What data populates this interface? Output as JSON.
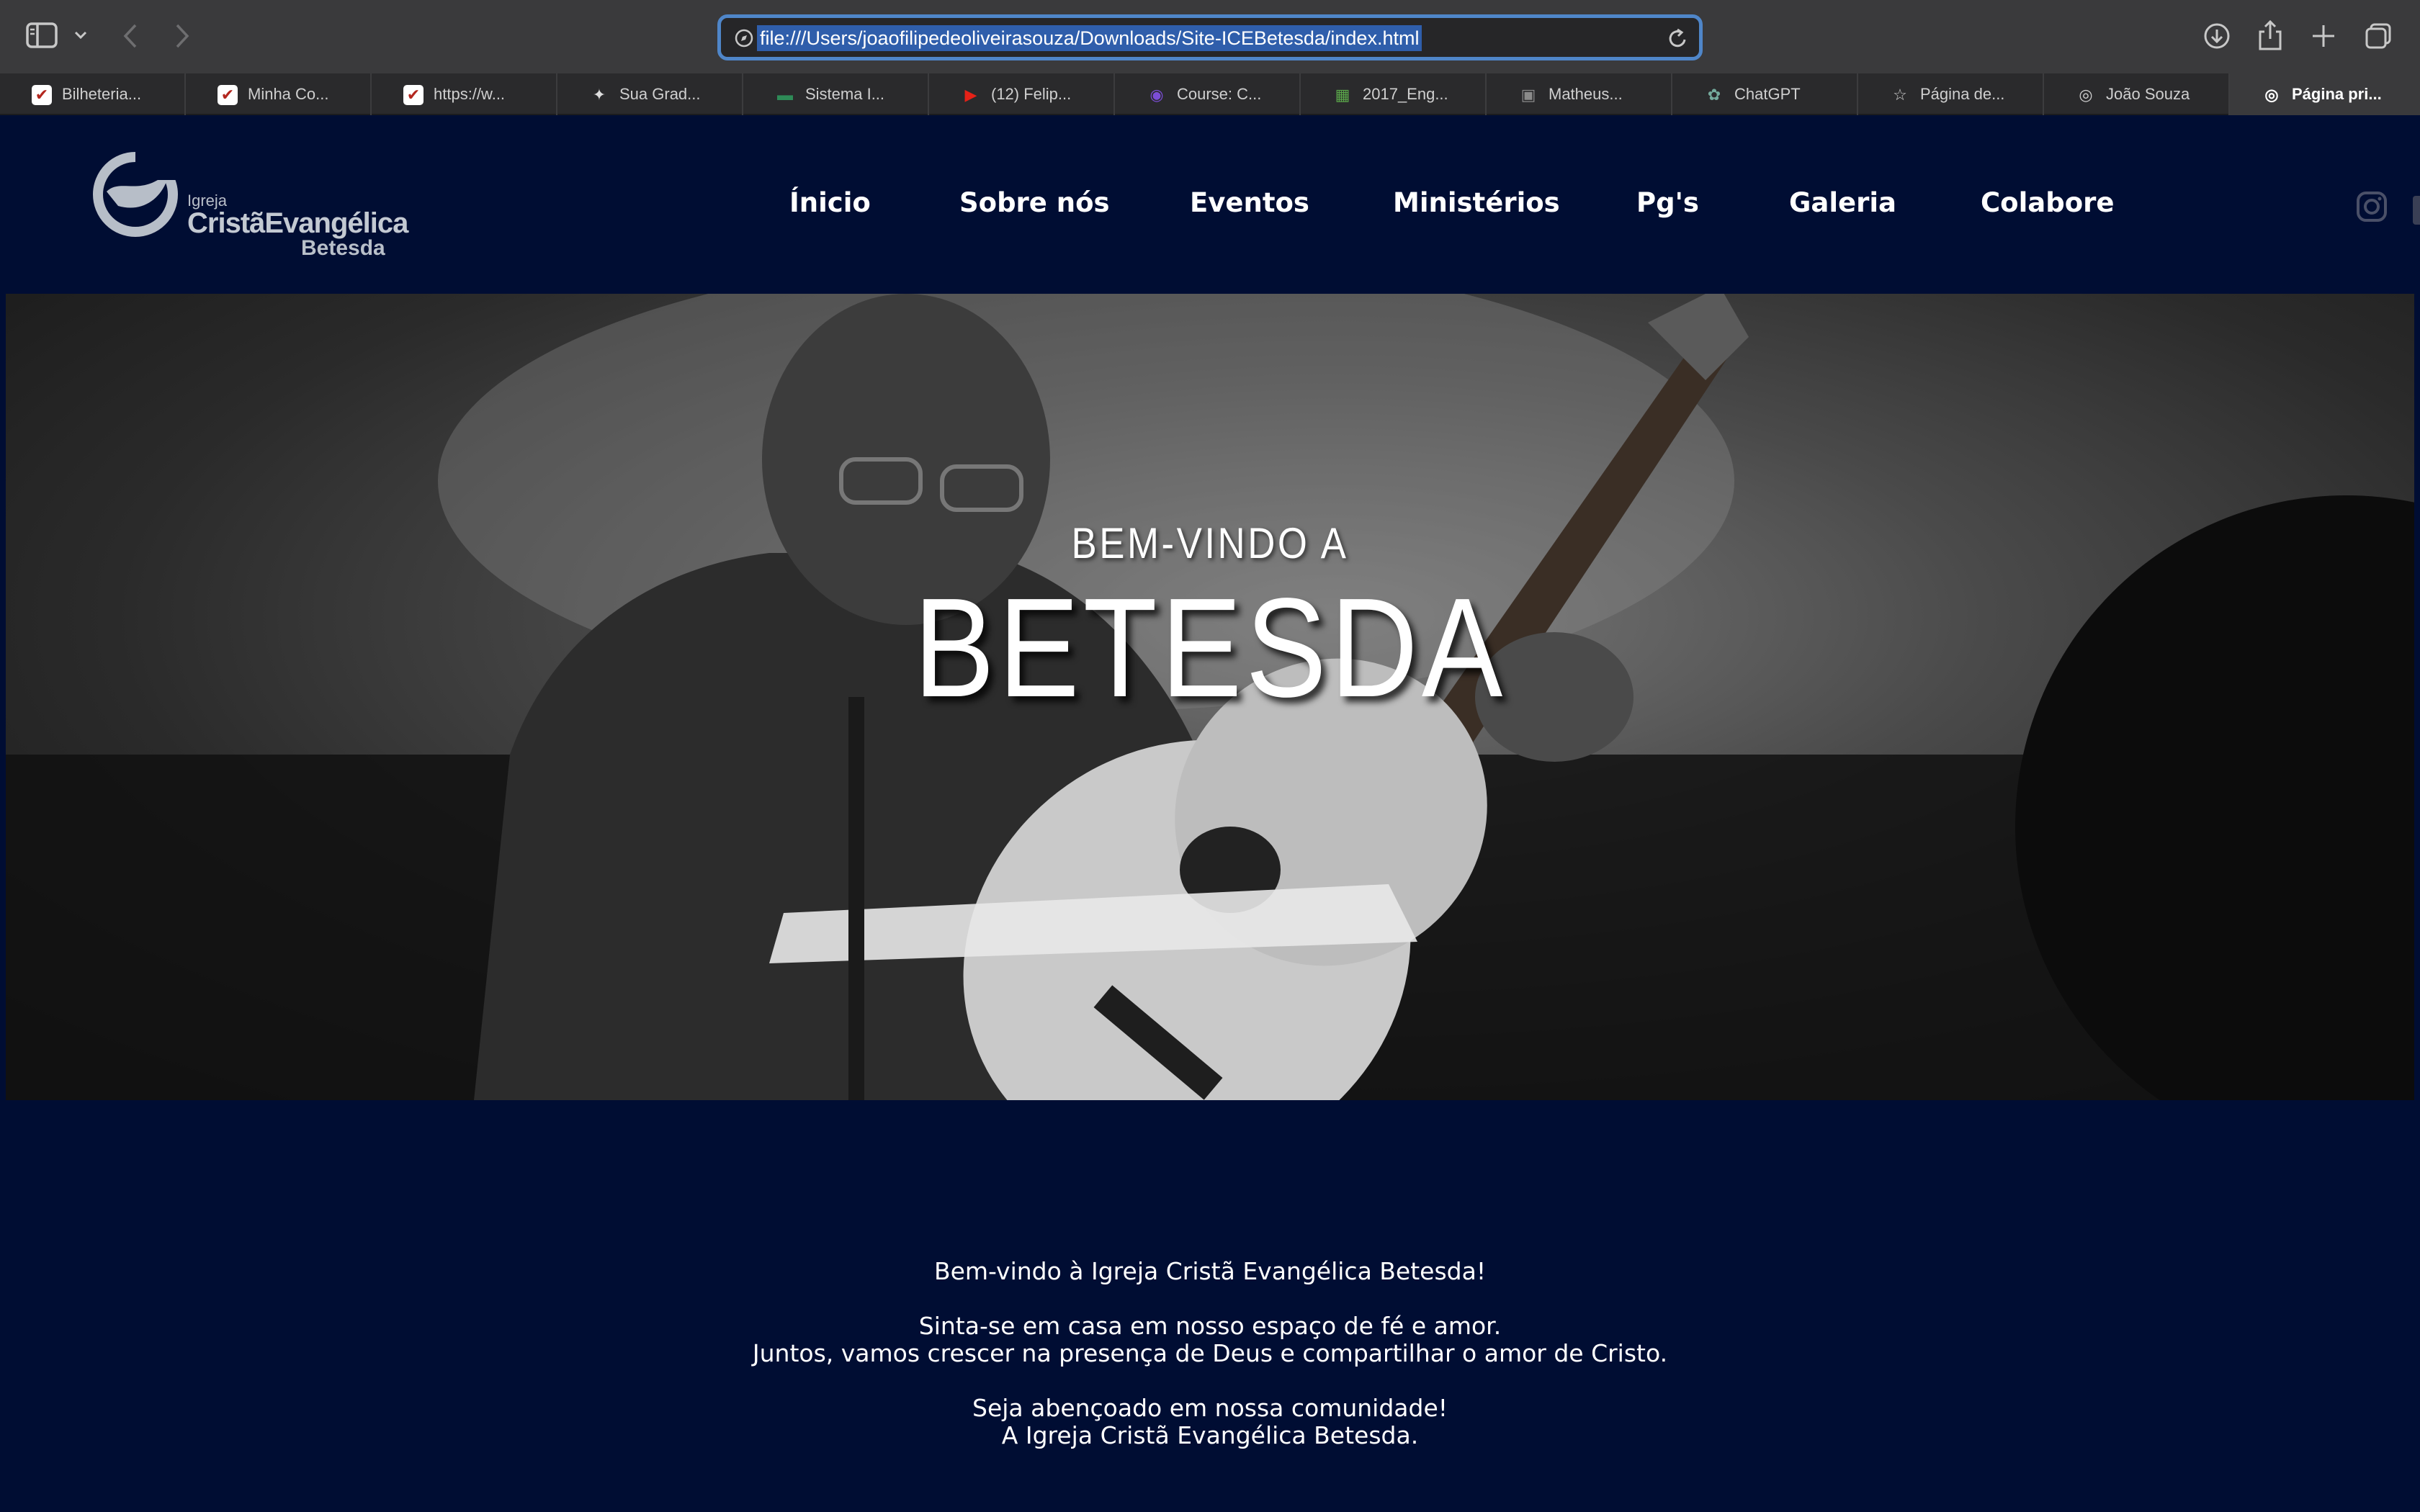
{
  "browser": {
    "url": "file:///Users/joaofilipedeoliveirasouza/Downloads/Site-ICEBetesda/index.html",
    "tabs": [
      {
        "label": "Bilheteria...",
        "icon": "ticket-icon",
        "color": "#ffffff"
      },
      {
        "label": "Minha Co...",
        "icon": "ticket-icon",
        "color": "#ffffff"
      },
      {
        "label": "https://w...",
        "icon": "ticket-icon",
        "color": "#ffffff"
      },
      {
        "label": "Sua Grad...",
        "icon": "cap-icon",
        "color": "#dddddd"
      },
      {
        "label": "Sistema I...",
        "icon": "flag-icon",
        "color": "#2e8b57"
      },
      {
        "label": "(12) Felip...",
        "icon": "youtube-icon",
        "color": "#e62117"
      },
      {
        "label": "Course: C...",
        "icon": "course-icon",
        "color": "#7b4dd6"
      },
      {
        "label": "2017_Eng...",
        "icon": "sheet-icon",
        "color": "#5aa64a"
      },
      {
        "label": "Matheus...",
        "icon": "photo-icon",
        "color": "#8a8a8a"
      },
      {
        "label": "ChatGPT",
        "icon": "chatgpt-icon",
        "color": "#74aa9c"
      },
      {
        "label": "Página de...",
        "icon": "star-icon",
        "color": "#cfcfcf"
      },
      {
        "label": "João Souza",
        "icon": "compass-icon",
        "color": "#cfcfcf"
      },
      {
        "label": "Página pri...",
        "icon": "compass-icon",
        "color": "#ffffff"
      }
    ]
  },
  "site": {
    "logo": {
      "line1": "Igreja",
      "line2": "CristãEvangélica",
      "line3": "Betesda"
    },
    "nav": [
      "Ínicio",
      "Sobre nós",
      "Eventos",
      "Ministérios",
      "Pg's",
      "Galeria",
      "Colabore"
    ],
    "hero": {
      "subtitle": "BEM-VINDO A",
      "title": "BETESDA"
    },
    "welcome": {
      "lines": [
        "Bem-vindo à Igreja Cristã Evangélica Betesda!",
        "Sinta-se em casa em nosso espaço de fé e amor.",
        "Juntos, vamos crescer na presença de Deus e compartilhar o amor de Cristo.",
        "Seja abençoado em nossa comunidade!",
        "A Igreja Cristã Evangélica Betesda."
      ]
    },
    "colors": {
      "background": "#000d33",
      "text": "#ffffff"
    }
  }
}
